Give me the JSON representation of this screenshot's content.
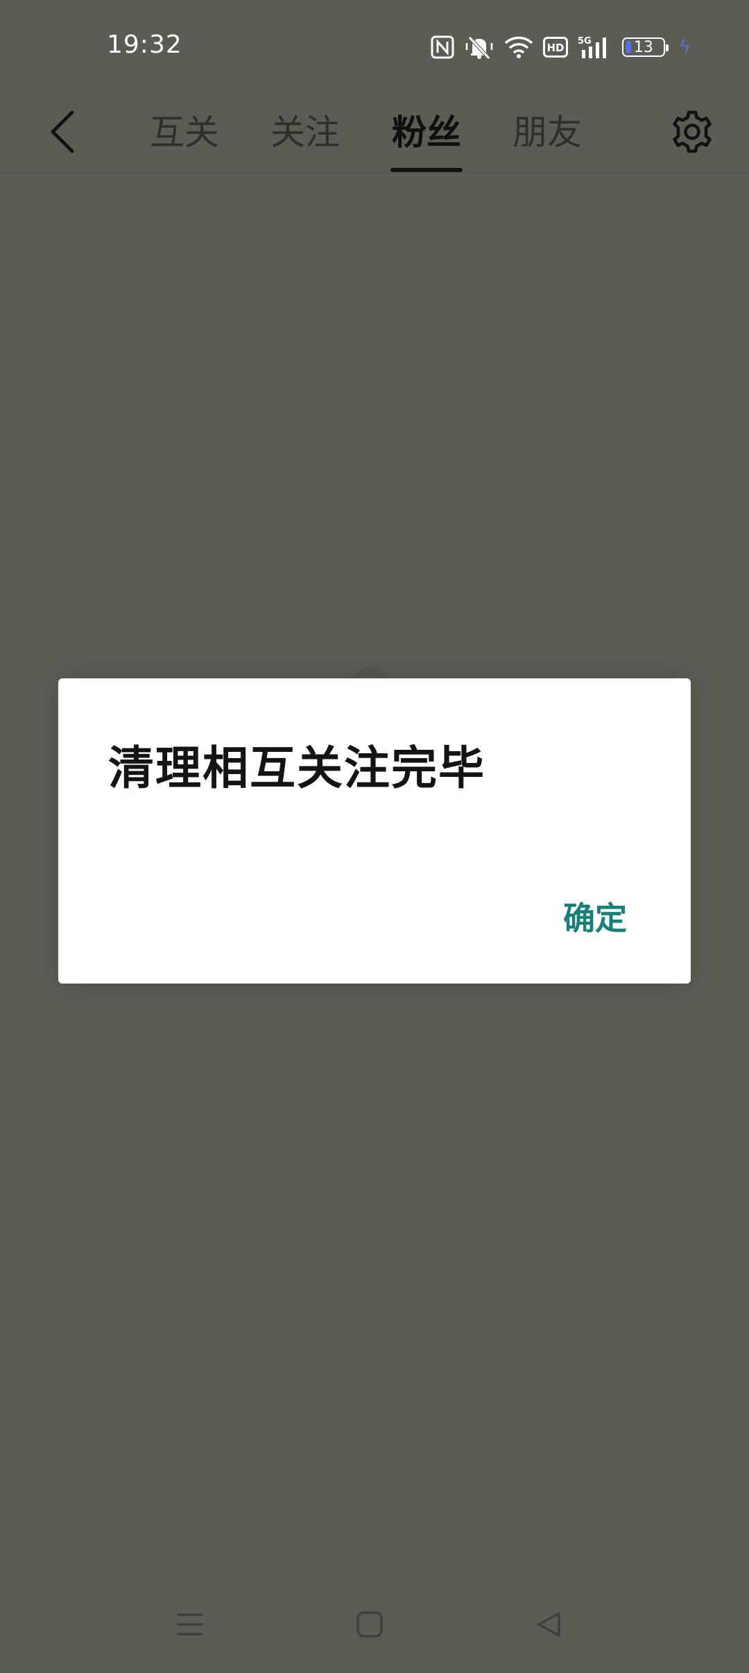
{
  "status_bar": {
    "time": "19:32",
    "icons": [
      "nfc-icon",
      "mute-icon",
      "wifi-icon",
      "hd-icon",
      "5g-signal-icon",
      "battery-icon",
      "charging-icon"
    ],
    "hd_label": "HD",
    "network_label": "5G",
    "battery_level": "13"
  },
  "top_nav": {
    "tabs": [
      {
        "label": "互关",
        "active": false
      },
      {
        "label": "关注",
        "active": false
      },
      {
        "label": "粉丝",
        "active": true
      },
      {
        "label": "朋友",
        "active": false
      }
    ]
  },
  "dialog": {
    "title": "清理相互关注完毕",
    "confirm_label": "确定"
  },
  "colors": {
    "overlay_background": "#5b5c54",
    "dialog_background": "#ffffff",
    "confirm_text": "#168079",
    "battery_accent": "#5a6fd8"
  }
}
